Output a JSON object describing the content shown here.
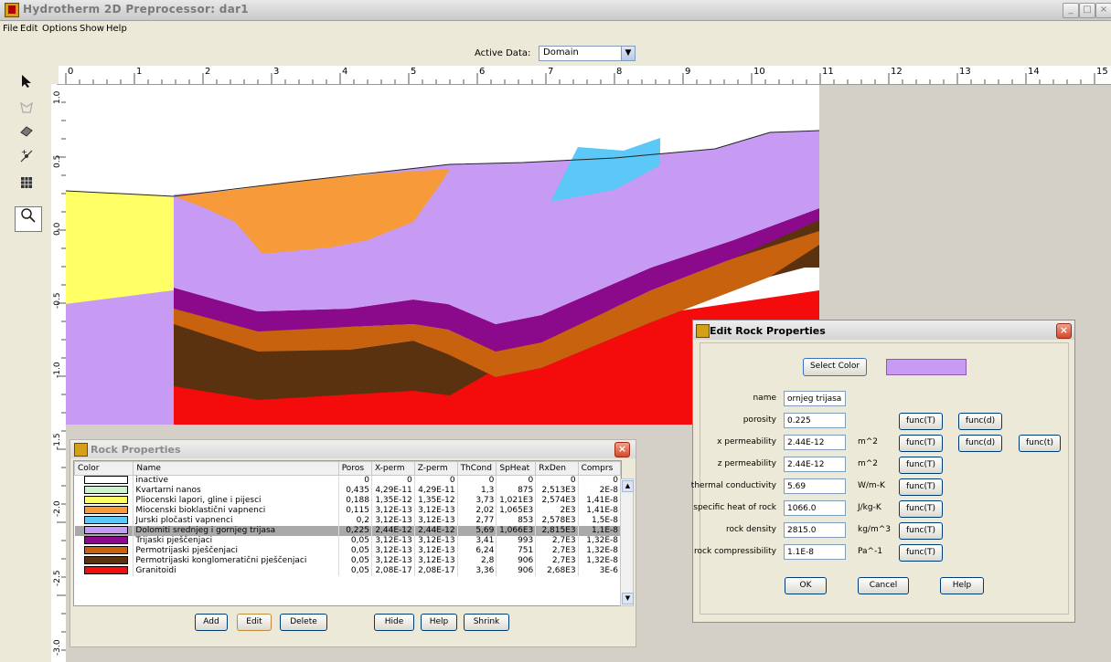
{
  "window": {
    "title": "Hydrotherm 2D Preprocessor: dar1"
  },
  "menu": [
    "File",
    "Edit",
    "Options",
    "Show",
    "Help"
  ],
  "active_data": {
    "label": "Active Data:",
    "value": "Domain"
  },
  "tools": [
    "pointer-icon",
    "polygon-icon",
    "eraser-icon",
    "point-icon",
    "grid-icon",
    "zoom-icon"
  ],
  "h_ruler": [
    "0",
    "1",
    "2",
    "3",
    "4",
    "5",
    "6",
    "7",
    "8",
    "9",
    "10",
    "11",
    "12",
    "13",
    "14",
    "15"
  ],
  "v_ruler": [
    "1.0",
    "0.5",
    "0.0",
    "-0.5",
    "-1.0",
    "-1.5",
    "-2.0",
    "-2.5",
    "-3.0"
  ],
  "rock_window": {
    "title": "Rock Properties",
    "columns": [
      "Color",
      "Name",
      "Poros",
      "X-perm",
      "Z-perm",
      "ThCond",
      "SpHeat",
      "RxDen",
      "Comprs"
    ],
    "rows": [
      {
        "color": "#ffffff",
        "name": "inactive",
        "poros": "0",
        "xperm": "0",
        "zperm": "0",
        "thcond": "0",
        "spheat": "0",
        "rxden": "0",
        "comprs": "0"
      },
      {
        "color": "#ccf2cc",
        "name": "Kvartarni nanos",
        "poros": "0,435",
        "xperm": "4,29E-11",
        "zperm": "4,29E-11",
        "thcond": "1,3",
        "spheat": "875",
        "rxden": "2,513E3",
        "comprs": "2E-8"
      },
      {
        "color": "#ffff66",
        "name": "Pliocenski lapori, gline i pijesci",
        "poros": "0,188",
        "xperm": "1,35E-12",
        "zperm": "1,35E-12",
        "thcond": "3,73",
        "spheat": "1,021E3",
        "rxden": "2,574E3",
        "comprs": "1,41E-8"
      },
      {
        "color": "#f79a3a",
        "name": "Miocenski bioklastični vapnenci",
        "poros": "0,115",
        "xperm": "3,12E-13",
        "zperm": "3,12E-13",
        "thcond": "2,02",
        "spheat": "1,065E3",
        "rxden": "2E3",
        "comprs": "1,41E-8"
      },
      {
        "color": "#5bc8f7",
        "name": "Jurski pločasti vapnenci",
        "poros": "0,2",
        "xperm": "3,12E-13",
        "zperm": "3,12E-13",
        "thcond": "2,77",
        "spheat": "853",
        "rxden": "2,578E3",
        "comprs": "1,5E-8"
      },
      {
        "color": "#c79bf4",
        "name": "Dolomiti srednjeg i gornjeg trijasa",
        "poros": "0,225",
        "xperm": "2,44E-12",
        "zperm": "2,44E-12",
        "thcond": "5,69",
        "spheat": "1,066E3",
        "rxden": "2,815E3",
        "comprs": "1,1E-8"
      },
      {
        "color": "#8b0a8b",
        "name": "Trijaski pješčenjaci",
        "poros": "0,05",
        "xperm": "3,12E-13",
        "zperm": "3,12E-13",
        "thcond": "3,41",
        "spheat": "993",
        "rxden": "2,7E3",
        "comprs": "1,32E-8"
      },
      {
        "color": "#c8620e",
        "name": "Permotrijaski pješčenjaci",
        "poros": "0,05",
        "xperm": "3,12E-13",
        "zperm": "3,12E-13",
        "thcond": "6,24",
        "spheat": "751",
        "rxden": "2,7E3",
        "comprs": "1,32E-8"
      },
      {
        "color": "#5a3210",
        "name": "Permotrijaski konglomeratični pješčenjaci",
        "poros": "0,05",
        "xperm": "3,12E-13",
        "zperm": "3,12E-13",
        "thcond": "2,8",
        "spheat": "906",
        "rxden": "2,7E3",
        "comprs": "1,32E-8"
      },
      {
        "color": "#f40b0b",
        "name": "Granitoidi",
        "poros": "0,05",
        "xperm": "2,08E-17",
        "zperm": "2,08E-17",
        "thcond": "3,36",
        "spheat": "906",
        "rxden": "2,68E3",
        "comprs": "3E-6"
      }
    ],
    "buttons": {
      "add": "Add",
      "edit": "Edit",
      "delete": "Delete",
      "hide": "Hide",
      "help": "Help",
      "shrink": "Shrink"
    }
  },
  "edit_window": {
    "title": "Edit Rock Properties",
    "select_color": "Select Color",
    "color_preview": "#c79bf4",
    "fields": [
      {
        "label": "name",
        "value": "ornjeg trijasa",
        "unit": "",
        "funcs": []
      },
      {
        "label": "porosity",
        "value": "0.225",
        "unit": "",
        "funcs": [
          "func(T)",
          "func(d)"
        ]
      },
      {
        "label": "x permeability",
        "value": "2.44E-12",
        "unit": "m^2",
        "funcs": [
          "func(T)",
          "func(d)",
          "func(t)"
        ]
      },
      {
        "label": "z permeability",
        "value": "2.44E-12",
        "unit": "m^2",
        "funcs": [
          "func(T)"
        ]
      },
      {
        "label": "thermal conductivity",
        "value": "5.69",
        "unit": "W/m-K",
        "funcs": [
          "func(T)"
        ]
      },
      {
        "label": "specific heat of rock",
        "value": "1066.0",
        "unit": "J/kg-K",
        "funcs": [
          "func(T)"
        ]
      },
      {
        "label": "rock density",
        "value": "2815.0",
        "unit": "kg/m^3",
        "funcs": [
          "func(T)"
        ]
      },
      {
        "label": "rock compressibility",
        "value": "1.1E-8",
        "unit": "Pa^-1",
        "funcs": [
          "func(T)"
        ]
      }
    ],
    "buttons": {
      "ok": "OK",
      "cancel": "Cancel",
      "help": "Help"
    }
  }
}
